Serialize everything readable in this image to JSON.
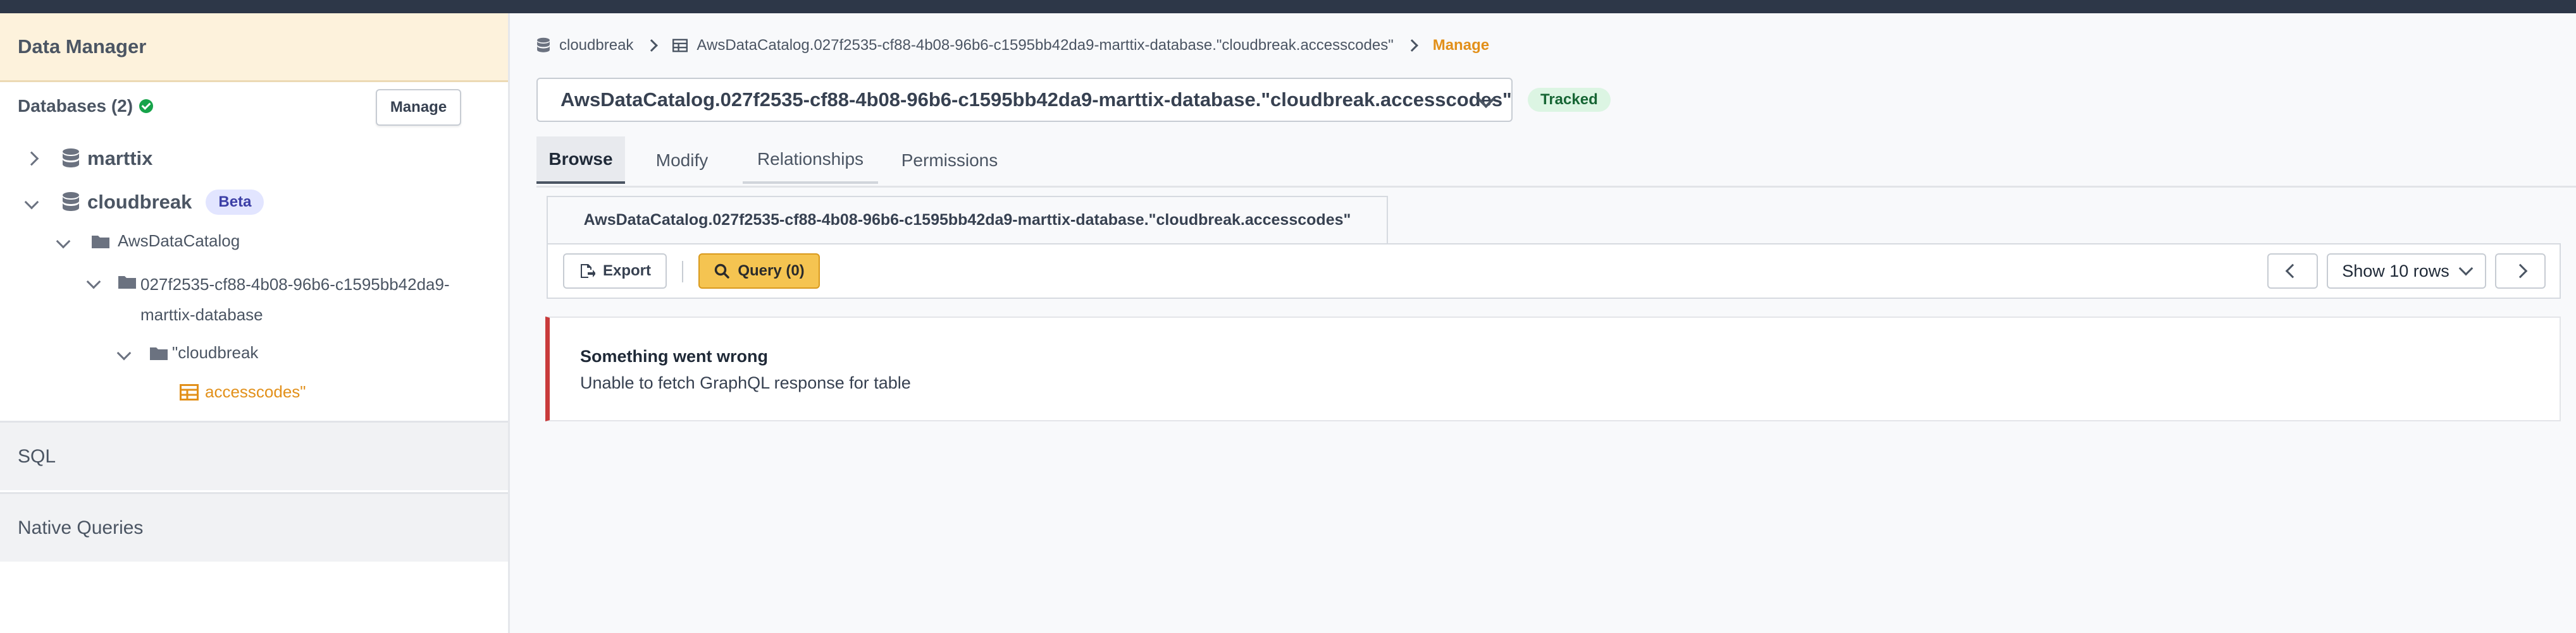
{
  "sidebar": {
    "title": "Data Manager",
    "databases_label": "Databases (2)",
    "manage_label": "Manage",
    "tree": {
      "db1": "marttix",
      "db2": "cloudbreak",
      "beta": "Beta",
      "catalog": "AwsDataCatalog",
      "schema_line1": "027f2535-cf88-4b08-96b6-c1595bb42da9-",
      "schema_line2": "marttix-database",
      "folder": "\"cloudbreak",
      "table": "accesscodes\""
    },
    "sections": [
      "SQL",
      "Native Queries"
    ]
  },
  "breadcrumb": {
    "items": [
      "cloudbreak",
      "AwsDataCatalog.027f2535-cf88-4b08-96b6-c1595bb42da9-marttix-database.\"cloudbreak.accesscodes\"",
      "Manage"
    ]
  },
  "table_selector": {
    "value": "AwsDataCatalog.027f2535-cf88-4b08-96b6-c1595bb42da9-marttix-database.\"cloudbreak.accesscodes\""
  },
  "status_badge": "Tracked",
  "tabs": [
    "Browse",
    "Modify",
    "Relationships",
    "Permissions"
  ],
  "active_tab": "Browse",
  "table_tab_label": "AwsDataCatalog.027f2535-cf88-4b08-96b6-c1595bb42da9-marttix-database.\"cloudbreak.accesscodes\"",
  "toolbar": {
    "export_label": "Export",
    "query_label": "Query (0)",
    "rows_label": "Show 10 rows"
  },
  "error": {
    "title": "Something went wrong",
    "message": "Unable to fetch GraphQL response for table"
  },
  "colors": {
    "accent": "#e2901a",
    "query_button": "#f5c451",
    "error_border": "#c93b3b",
    "tracked_bg": "#dcf5e3"
  },
  "icons": [
    "check-icon",
    "database-icon",
    "folder-icon",
    "table-icon",
    "chevron-icon",
    "export-icon",
    "search-icon"
  ]
}
